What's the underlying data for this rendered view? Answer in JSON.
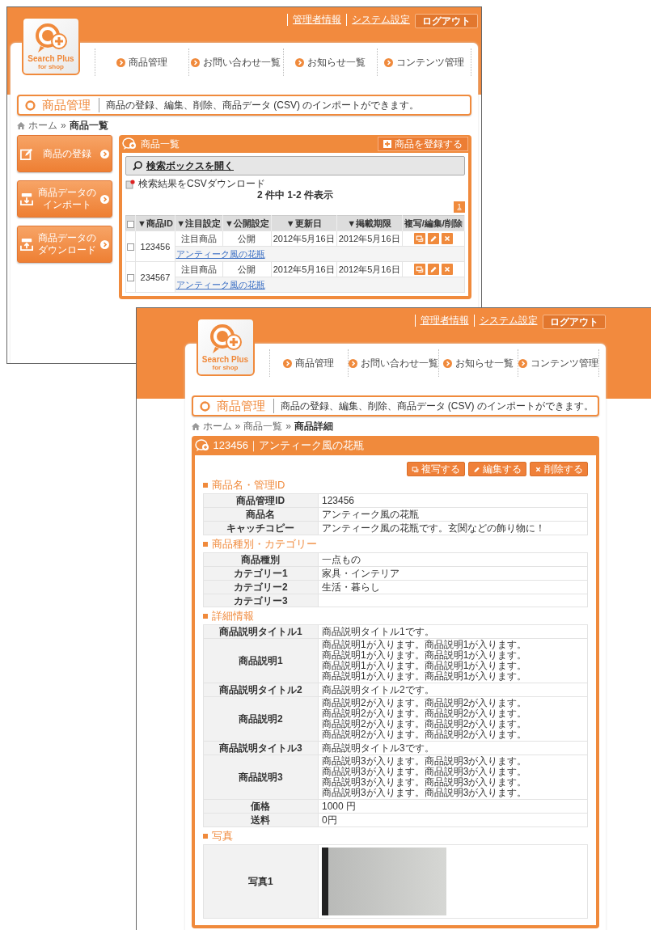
{
  "list_window": {
    "header": {
      "logo_title": "Search Plus",
      "logo_subtitle": "for shop",
      "links": [
        "管理者情報",
        "システム設定"
      ],
      "logout": "ログアウト"
    },
    "nav": [
      "商品管理",
      "お問い合わせ一覧",
      "お知らせ一覧",
      "コンテンツ管理"
    ],
    "page_title": "商品管理",
    "page_description": "商品の登録、編集、削除、商品データ (CSV) のインポートができます。",
    "breadcrumb": {
      "separator": "»",
      "items": [
        {
          "label": "ホーム",
          "link": true
        },
        {
          "label": "商品一覧",
          "link": false
        }
      ]
    },
    "side_buttons": [
      {
        "kind": "register",
        "lines": [
          "商品の登録"
        ]
      },
      {
        "kind": "import",
        "lines": [
          "商品データの",
          "インポート"
        ]
      },
      {
        "kind": "download",
        "lines": [
          "商品データの",
          "ダウンロード"
        ]
      }
    ],
    "panel": {
      "title": "商品一覧",
      "register_button": "商品を登録する",
      "search_toggle": "検索ボックスを開く",
      "csv_link": "検索結果をCSVダウンロード",
      "count": "2 件中 1-2 件表示",
      "pages": [
        {
          "label": "1",
          "selected": true
        }
      ],
      "select_all_checked": false,
      "columns": [
        "▼商品ID",
        "▼注目設定",
        "▼公開設定",
        "▼更新日",
        "▼掲載期限",
        "複写/編集/削除"
      ],
      "rows": [
        {
          "checked": false,
          "id": "123456",
          "featured": "注目商品",
          "visibility": "公開",
          "updated": "2012年5月16日",
          "expires": "2012年5月16日",
          "name": "アンティーク風の花瓶"
        },
        {
          "checked": false,
          "id": "234567",
          "featured": "注目商品",
          "visibility": "公開",
          "updated": "2012年5月16日",
          "expires": "2012年5月16日",
          "name": "アンティーク風の花瓶"
        }
      ]
    }
  },
  "detail_window": {
    "header": {
      "logo_title": "Search Plus",
      "logo_subtitle": "for shop",
      "links": [
        "管理者情報",
        "システム設定"
      ],
      "logout": "ログアウト"
    },
    "nav": [
      "商品管理",
      "お問い合わせ一覧",
      "お知らせ一覧",
      "コンテンツ管理"
    ],
    "page_title": "商品管理",
    "page_description": "商品の登録、編集、削除、商品データ (CSV) のインポートができます。",
    "breadcrumb": {
      "separator": "»",
      "items": [
        {
          "label": "ホーム",
          "link": true
        },
        {
          "label": "商品一覧",
          "link": true
        },
        {
          "label": "商品詳細",
          "link": false
        }
      ]
    },
    "panel": {
      "title": "123456｜アンティーク風の花瓶",
      "actions": [
        {
          "kind": "copy",
          "label": "複写する"
        },
        {
          "kind": "edit",
          "label": "編集する"
        },
        {
          "kind": "delete",
          "label": "削除する"
        }
      ],
      "sections": [
        {
          "title": "商品名・管理ID",
          "rows": [
            {
              "kind": "text",
              "label": "商品管理ID",
              "value": "123456"
            },
            {
              "kind": "text",
              "label": "商品名",
              "value": "アンティーク風の花瓶"
            },
            {
              "kind": "text",
              "label": "キャッチコピー",
              "value": "アンティーク風の花瓶です。玄関などの飾り物に！"
            }
          ]
        },
        {
          "title": "商品種別・カテゴリー",
          "rows": [
            {
              "kind": "text",
              "label": "商品種別",
              "value": "一点もの"
            },
            {
              "kind": "text",
              "label": "カテゴリー1",
              "value": "家具・インテリア"
            },
            {
              "kind": "text",
              "label": "カテゴリー2",
              "value": "生活・暮らし"
            },
            {
              "kind": "text",
              "label": "カテゴリー3"
            }
          ]
        },
        {
          "title": "詳細情報",
          "rows": [
            {
              "kind": "text",
              "label": "商品説明タイトル1",
              "value": "商品説明タイトル1です。"
            },
            {
              "kind": "text",
              "label": "商品説明1",
              "value": "商品説明1が入ります。商品説明1が入ります。商品説明1が入ります。商品説明1が入ります。商品説明1が入ります。商品説明1が入ります。商品説明1が入ります。商品説明1が入ります。"
            },
            {
              "kind": "text",
              "label": "商品説明タイトル2",
              "value": "商品説明タイトル2です。"
            },
            {
              "kind": "text",
              "label": "商品説明2",
              "value": "商品説明2が入ります。商品説明2が入ります。商品説明2が入ります。商品説明2が入ります。商品説明2が入ります。商品説明2が入ります。商品説明2が入ります。商品説明2が入ります。"
            },
            {
              "kind": "text",
              "label": "商品説明タイトル3",
              "value": "商品説明タイトル3です。"
            },
            {
              "kind": "text",
              "label": "商品説明3",
              "value": "商品説明3が入ります。商品説明3が入ります。商品説明3が入ります。商品説明3が入ります。商品説明3が入ります。商品説明3が入ります。商品説明3が入ります。商品説明3が入ります。"
            },
            {
              "kind": "text",
              "label": "価格",
              "value": "1000 円"
            },
            {
              "kind": "text",
              "label": "送料",
              "value": "0円"
            }
          ]
        },
        {
          "title": "写真",
          "rows": [
            {
              "kind": "photo",
              "label": "写真1"
            }
          ]
        }
      ]
    }
  }
}
